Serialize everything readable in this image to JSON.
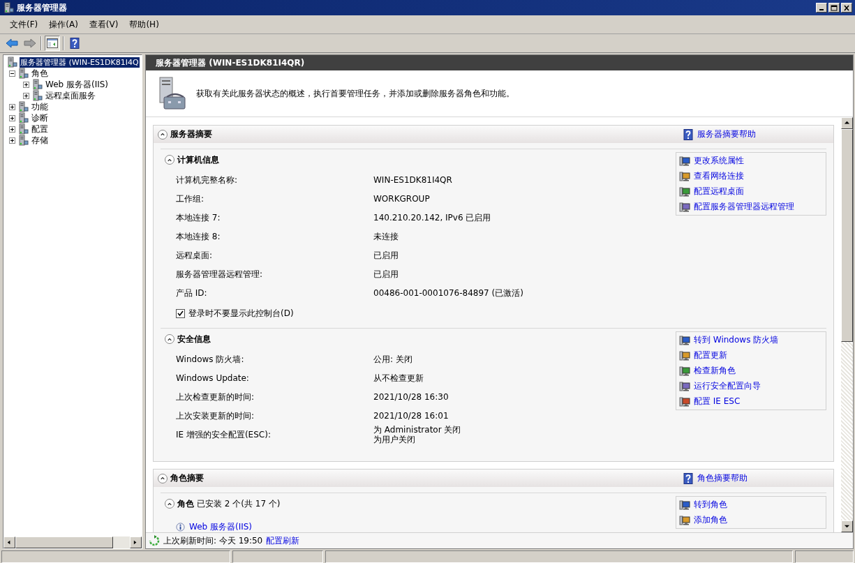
{
  "window": {
    "title": "服务器管理器"
  },
  "menu": [
    "文件(F)",
    "操作(A)",
    "查看(V)",
    "帮助(H)"
  ],
  "tree": [
    {
      "label": "服务器管理器 (WIN-ES1DK81I4Q",
      "selected": true,
      "children": [
        {
          "label": "角色",
          "selected": false,
          "expanded": true,
          "children": [
            {
              "label": "Web 服务器(IIS)",
              "selected": false,
              "expanded": false
            },
            {
              "label": "远程桌面服务",
              "selected": false,
              "expanded": false
            }
          ]
        },
        {
          "label": "功能",
          "selected": false,
          "expanded": false
        },
        {
          "label": "诊断",
          "selected": false,
          "expanded": false
        },
        {
          "label": "配置",
          "selected": false,
          "expanded": false
        },
        {
          "label": "存储",
          "selected": false,
          "expanded": false
        }
      ]
    }
  ],
  "header": {
    "title": "服务器管理器 (WIN-ES1DK81I4QR)",
    "description": "获取有关此服务器状态的概述，执行首要管理任务，并添加或删除服务器角色和功能。"
  },
  "sections": [
    {
      "title": "服务器摘要",
      "expanded": true,
      "help": "服务器摘要帮助",
      "groups": [
        {
          "title": "计算机信息",
          "expanded": true,
          "rows": [
            {
              "label": "计算机完整名称:",
              "values": [
                "WIN-ES1DK81I4QR"
              ]
            },
            {
              "label": "工作组:",
              "values": [
                "WORKGROUP"
              ]
            },
            {
              "label": "本地连接 7:",
              "values": [
                "140.210.20.142, IPv6 已启用"
              ]
            },
            {
              "label": "本地连接 8:",
              "values": [
                "未连接"
              ]
            },
            {
              "label": "远程桌面:",
              "values": [
                "已启用"
              ]
            },
            {
              "label": "服务器管理器远程管理:",
              "values": [
                "已启用"
              ]
            },
            {
              "label": "产品 ID:",
              "values": [
                "00486-001-0001076-84897 (已激活)"
              ]
            }
          ],
          "checkbox": {
            "label": "登录时不要显示此控制台(D)",
            "checked": true
          },
          "tasks": [
            "更改系统属性",
            "查看网络连接",
            "配置远程桌面",
            "配置服务器管理器远程管理"
          ]
        },
        {
          "title": "安全信息",
          "expanded": true,
          "rows": [
            {
              "label": "Windows 防火墙:",
              "values": [
                "公用: 关闭"
              ]
            },
            {
              "label": "Windows Update:",
              "values": [
                "从不检查更新"
              ]
            },
            {
              "label": "上次检查更新的时间:",
              "values": [
                "2021/10/28 16:30"
              ]
            },
            {
              "label": "上次安装更新的时间:",
              "values": [
                "2021/10/28 16:01"
              ]
            },
            {
              "label": "IE 增强的安全配置(ESC):",
              "values": [
                "为 Administrator 关闭",
                "为用户关闭"
              ]
            }
          ],
          "tasks": [
            "转到 Windows 防火墙",
            "配置更新",
            "检查新角色",
            "运行安全配置向导",
            "配置 IE ESC"
          ]
        }
      ]
    },
    {
      "title": "角色摘要",
      "expanded": true,
      "help": "角色摘要帮助",
      "groups": [
        {
          "title": "角色",
          "summary": "已安装 2 个(共 17 个)",
          "expanded": true,
          "items": [
            "Web 服务器(IIS)"
          ],
          "tasks": [
            "转到角色",
            "添加角色"
          ]
        }
      ]
    }
  ],
  "footer": {
    "refresh": "上次刷新时间: 今天 19:50",
    "link": "配置刷新"
  }
}
